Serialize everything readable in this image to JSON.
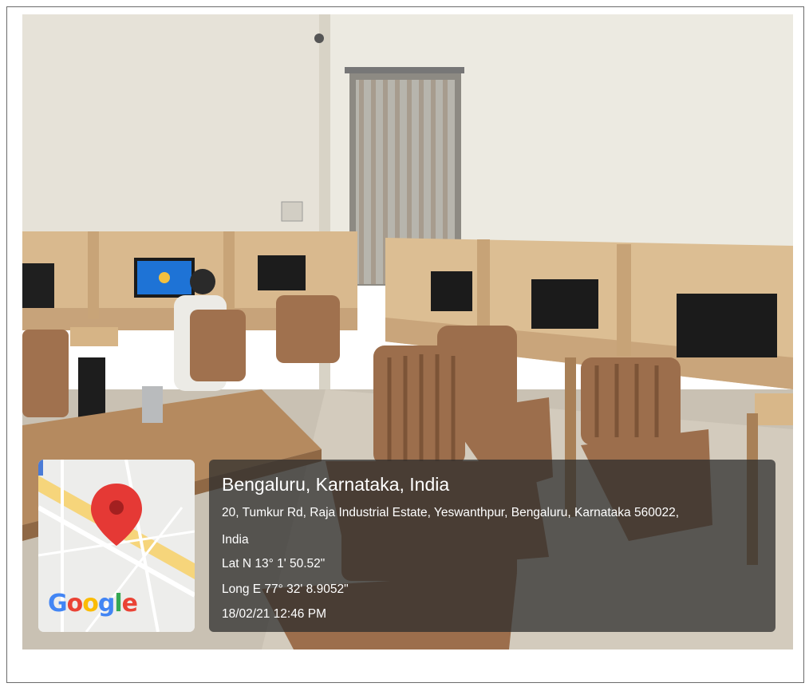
{
  "geotag": {
    "city_line": "Bengaluru, Karnataka, India",
    "address_line1": "20, Tumkur Rd, Raja Industrial Estate, Yeswanthpur, Bengaluru, Karnataka 560022,",
    "address_line2": "India",
    "latitude": "Lat N 13° 1' 50.52\"",
    "longitude": "Long E 77° 32' 8.9052\"",
    "datetime": "18/02/21 12:46 PM"
  },
  "map_thumbnail": {
    "logo_text": "Google",
    "pin_icon": "map-pin-icon",
    "pin_color": "#e53935"
  },
  "colors": {
    "wall": "#e9e5da",
    "desk_wood": "#d9b98e",
    "chair_wood": "#9c6e4c",
    "overlay": "#2d2d2d"
  }
}
